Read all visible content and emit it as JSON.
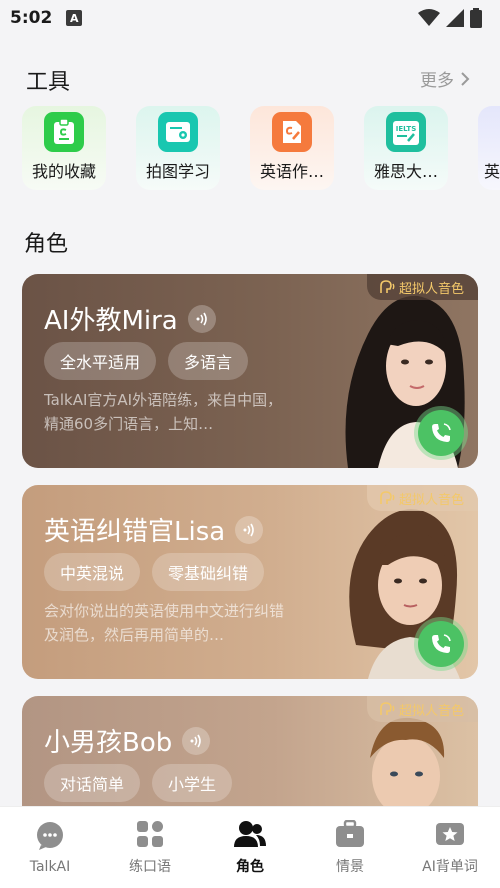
{
  "status_bar": {
    "time": "5:02",
    "a_badge": "A"
  },
  "tools": {
    "title": "工具",
    "more_label": "更多",
    "items": [
      {
        "label": "我的收藏",
        "icon": "bookmark-clipboard-icon",
        "color": "#2ecc4a"
      },
      {
        "label": "拍图学习",
        "icon": "camera-card-icon",
        "color": "#19c7b0"
      },
      {
        "label": "英语作…",
        "icon": "document-pen-icon",
        "color": "#f57a3d"
      },
      {
        "label": "雅思大…",
        "icon": "ielts-clipboard-icon",
        "color": "#1fbf9e"
      },
      {
        "label": "英"
      }
    ]
  },
  "roles": {
    "title": "角色",
    "badge": "超拟人音色",
    "cards": [
      {
        "name": "AI外教Mira",
        "tags": [
          "全水平适用",
          "多语言"
        ],
        "desc": "TalkAI官方AI外语陪练，来自中国，精通60多门语言，上知…",
        "bg": "#6b5346"
      },
      {
        "name": "英语纠错官Lisa",
        "tags": [
          "中英混说",
          "零基础纠错"
        ],
        "desc": "会对你说出的英语使用中文进行纠错及润色，然后再用简单的…",
        "bg": "#c9a584"
      },
      {
        "name": "小男孩Bob",
        "tags": [
          "对话简单",
          "小学生"
        ],
        "desc": "",
        "bg": "#b79a86"
      }
    ]
  },
  "nav": {
    "items": [
      {
        "label": "TalkAI",
        "icon": "chat-bubble-icon",
        "active": false
      },
      {
        "label": "练口语",
        "icon": "grid-apps-icon",
        "active": false
      },
      {
        "label": "角色",
        "icon": "people-icon",
        "active": true
      },
      {
        "label": "情景",
        "icon": "briefcase-icon",
        "active": false
      },
      {
        "label": "AI背单词",
        "icon": "star-card-icon",
        "active": false
      }
    ]
  }
}
